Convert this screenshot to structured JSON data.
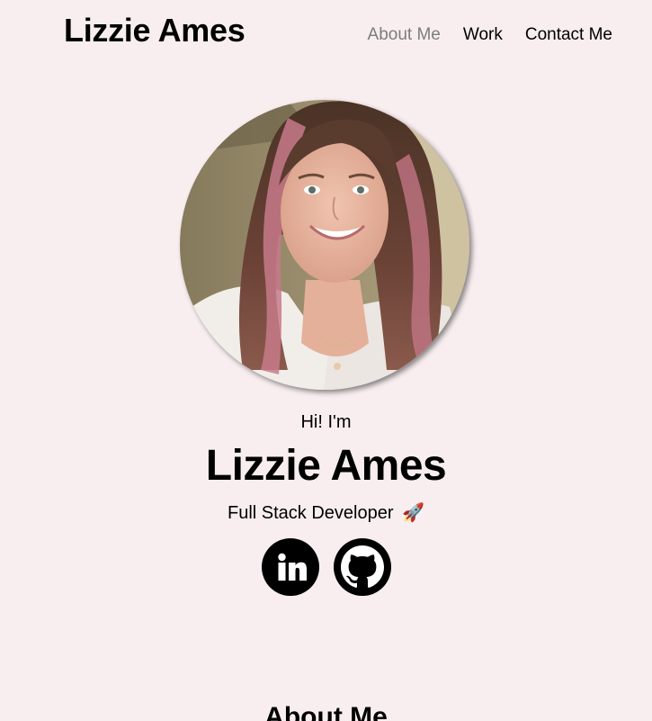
{
  "header": {
    "brand": "Lizzie Ames",
    "nav": [
      {
        "label": "About Me",
        "active": true
      },
      {
        "label": "Work",
        "active": false
      },
      {
        "label": "Contact Me",
        "active": false
      }
    ]
  },
  "hero": {
    "greeting": "Hi! I'm",
    "name": "Lizzie Ames",
    "role": "Full Stack Developer",
    "role_emoji": "🚀",
    "avatar_alt": "Profile photo",
    "socials": [
      {
        "icon": "linkedin-icon"
      },
      {
        "icon": "github-icon"
      }
    ]
  },
  "sections": {
    "about_title": "About Me"
  },
  "colors": {
    "background": "#f8eef0",
    "text": "#000000",
    "nav_active": "#7d7d7d"
  }
}
